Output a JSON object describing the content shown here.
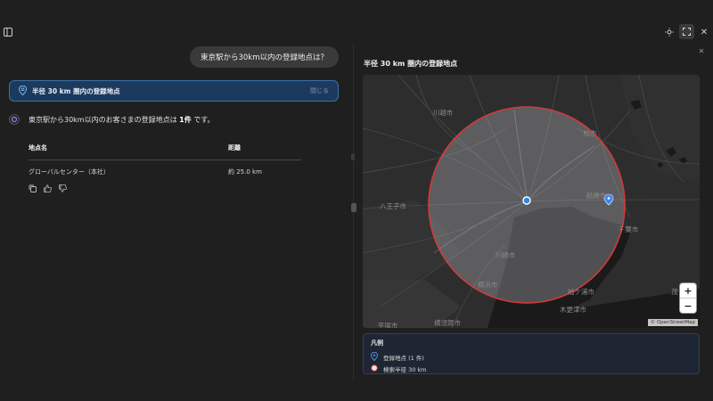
{
  "user_message": "東京駅から30km以内の登録地点は？",
  "tool_card": {
    "title": "半径 30 km 圏内の登録地点",
    "close_label": "閉じる"
  },
  "answer": {
    "prefix": "東京駅から30km以内のお客さまの登録地点は ",
    "count": "1件",
    "suffix": " です。"
  },
  "table": {
    "headers": [
      "地点名",
      "距離"
    ],
    "rows": [
      [
        "グローバルセンター（本社）",
        "約 25.0 km"
      ]
    ]
  },
  "panel": {
    "title": "半径 30 km 圏内の登録地点"
  },
  "map": {
    "labels": {
      "kawagoe": "川越市",
      "kashiwa": "柏市",
      "hachioji": "八王子市",
      "funabashi": "船橋市",
      "chiba": "千葉市",
      "kawasaki": "川崎市",
      "yokohama": "横浜市",
      "sodegaura": "袖ケ浦市",
      "kisarazu": "木更津市",
      "hiratsuka": "平塚市",
      "yokosuka": "横須賀市",
      "motomi": "茂"
    },
    "zoom_in": "+",
    "zoom_out": "−",
    "attribution": "© OpenStreetMap",
    "colors": {
      "radius_stroke": "#d23a3a",
      "center_marker": "#2a8be0",
      "pin": "#3b82f6"
    }
  },
  "legend": {
    "title": "凡例",
    "items": [
      {
        "icon": "pin-icon",
        "label": "登録地点 (1 件)"
      },
      {
        "icon": "circle-icon",
        "label": "検索半径 30 km"
      }
    ]
  }
}
